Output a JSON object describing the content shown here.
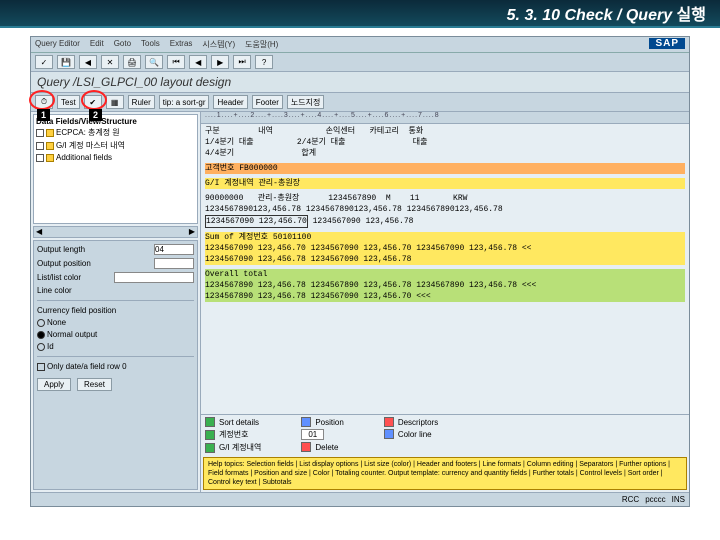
{
  "slide": {
    "title_num": "5. 3. 10",
    "title_en": "Check / Query",
    "title_kr": "실행"
  },
  "menu": [
    "Query Editor",
    "Edit",
    "Goto",
    "Tools",
    "Extras",
    "시스템(Y)",
    "도움말(H)"
  ],
  "sap_logo": "SAP",
  "app_title": "Query /LSI_GLPCI_00 layout design",
  "tb1": {
    "test": "Test",
    "ruler": "Ruler",
    "tip": "tip: a sort-gr",
    "header": "Header",
    "footer": "Footer",
    "node": "노드지정"
  },
  "callouts": {
    "c1": "1",
    "c2": "2"
  },
  "tree": {
    "title": "Data Fields/View/Structure",
    "items": [
      {
        "label": "ECPCA: 총계정 원"
      },
      {
        "label": "G/I 계정 마스터 내역"
      },
      {
        "label": "Additional fields"
      }
    ]
  },
  "props": {
    "output_length": "Output length",
    "output_length_val": "04",
    "output_pos": "Output position",
    "list_color": "List/list color",
    "line_color": "Line color",
    "curr_caption": "Currency field position",
    "radios": [
      "None",
      "Normal output",
      "Id"
    ],
    "check": "Only date/a field row 0",
    "apply": "Apply",
    "reset": "Reset"
  },
  "ruler": "....1....+....2....+....3....+....4....+....5....+....6....+....7....8",
  "report": {
    "h1": "구분        내역           손익센터   카테고리  통화",
    "h2": "1/4분기 대출         2/4분기 대출              대출",
    "h3": "4/4분기              합계",
    "band1": "고객번호 FB000000",
    "band2": "G/I 계정내역 관리-총원장",
    "d1": "90000000   관리-총원장      1234567890  M    11       KRW",
    "d2": "1234567890123,456.78 1234567890123,456.78 1234567890123,456.78",
    "d3_box": "1234567090 123,456.70",
    "d3_rest": " 1234567090 123,456.78",
    "sum": "Sum of 계정번호 50101100",
    "s1": "1234567090 123,456.70 1234567090 123,456.70 1234567090 123,456.78 <<",
    "s2": "1234567090 123,456.78 1234567090 123,456.78",
    "overall": "Overall total",
    "t1": "1234567890 123,456.78 1234567890 123,456.78 1234567890 123,456.78 <<<",
    "t2": "1234567890 123,456.78 1234567090 123,456.70 <<<"
  },
  "legend": {
    "col1a": "Sort   details",
    "col1b": "계정번호",
    "col1c": "G/I 계정내역",
    "col2a": "Position",
    "col2b": "01",
    "col2c": "Delete",
    "col3a": "Descriptors",
    "col3b": "Color line"
  },
  "help": "Help topics: Selection fields | List display options | List size (color) | Header and footers | Line formats | Column editing | Separators | Further options | Field formats | Position and size | Color | Totaling counter. Output template: currency and quantity fields | Further totals | Control levels | Sort order | Control key text | Subtotals",
  "status": {
    "a": "RCC",
    "b": "pcccc",
    "c": "INS"
  }
}
